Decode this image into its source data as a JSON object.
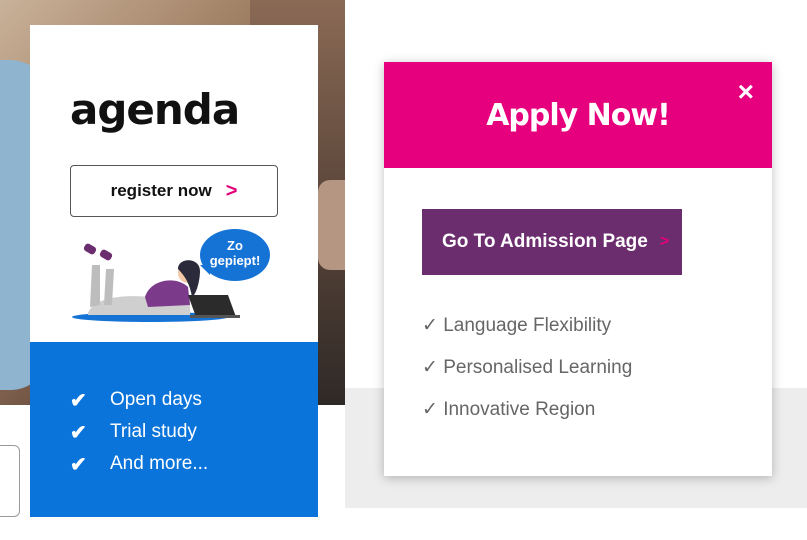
{
  "agenda": {
    "title": "agenda",
    "register_label": "register now",
    "register_chevron": ">",
    "bubble_text": "Zo gepiept!",
    "benefits": [
      "Open days",
      "Trial study",
      "And more..."
    ],
    "check_icon": "✔"
  },
  "popup": {
    "title": "Apply Now!",
    "close_icon": "×",
    "admission_label": "Go To Admission Page",
    "admission_chevron": ">",
    "features": [
      "✓ Language Flexibility",
      "✓ Personalised Learning",
      "✓ Innovative Region"
    ]
  },
  "colors": {
    "popup_header": "#e6007e",
    "admission_button": "#6b2d6e",
    "benefits_panel": "#0a74da",
    "accent_chevron": "#e2007a"
  }
}
